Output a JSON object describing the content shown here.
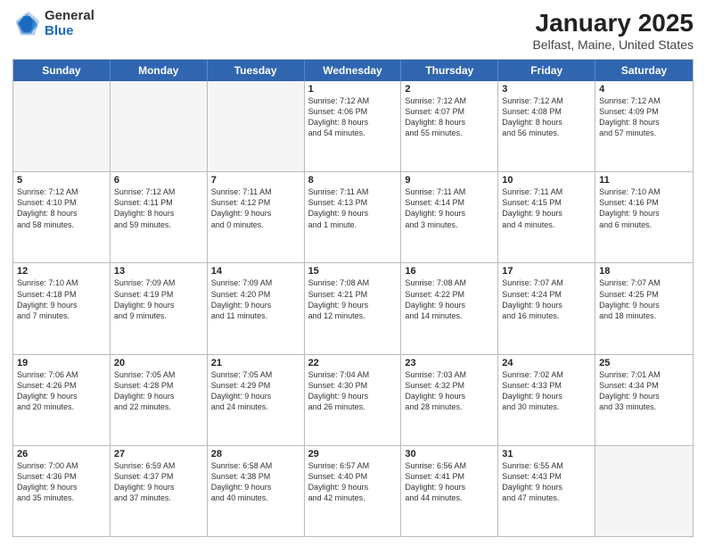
{
  "logo": {
    "general": "General",
    "blue": "Blue"
  },
  "title": {
    "month": "January 2025",
    "location": "Belfast, Maine, United States"
  },
  "header_days": [
    "Sunday",
    "Monday",
    "Tuesday",
    "Wednesday",
    "Thursday",
    "Friday",
    "Saturday"
  ],
  "rows": [
    [
      {
        "day": "",
        "info": "",
        "empty": true
      },
      {
        "day": "",
        "info": "",
        "empty": true
      },
      {
        "day": "",
        "info": "",
        "empty": true
      },
      {
        "day": "1",
        "info": "Sunrise: 7:12 AM\nSunset: 4:06 PM\nDaylight: 8 hours\nand 54 minutes.",
        "empty": false
      },
      {
        "day": "2",
        "info": "Sunrise: 7:12 AM\nSunset: 4:07 PM\nDaylight: 8 hours\nand 55 minutes.",
        "empty": false
      },
      {
        "day": "3",
        "info": "Sunrise: 7:12 AM\nSunset: 4:08 PM\nDaylight: 8 hours\nand 56 minutes.",
        "empty": false
      },
      {
        "day": "4",
        "info": "Sunrise: 7:12 AM\nSunset: 4:09 PM\nDaylight: 8 hours\nand 57 minutes.",
        "empty": false
      }
    ],
    [
      {
        "day": "5",
        "info": "Sunrise: 7:12 AM\nSunset: 4:10 PM\nDaylight: 8 hours\nand 58 minutes.",
        "empty": false
      },
      {
        "day": "6",
        "info": "Sunrise: 7:12 AM\nSunset: 4:11 PM\nDaylight: 8 hours\nand 59 minutes.",
        "empty": false
      },
      {
        "day": "7",
        "info": "Sunrise: 7:11 AM\nSunset: 4:12 PM\nDaylight: 9 hours\nand 0 minutes.",
        "empty": false
      },
      {
        "day": "8",
        "info": "Sunrise: 7:11 AM\nSunset: 4:13 PM\nDaylight: 9 hours\nand 1 minute.",
        "empty": false
      },
      {
        "day": "9",
        "info": "Sunrise: 7:11 AM\nSunset: 4:14 PM\nDaylight: 9 hours\nand 3 minutes.",
        "empty": false
      },
      {
        "day": "10",
        "info": "Sunrise: 7:11 AM\nSunset: 4:15 PM\nDaylight: 9 hours\nand 4 minutes.",
        "empty": false
      },
      {
        "day": "11",
        "info": "Sunrise: 7:10 AM\nSunset: 4:16 PM\nDaylight: 9 hours\nand 6 minutes.",
        "empty": false
      }
    ],
    [
      {
        "day": "12",
        "info": "Sunrise: 7:10 AM\nSunset: 4:18 PM\nDaylight: 9 hours\nand 7 minutes.",
        "empty": false
      },
      {
        "day": "13",
        "info": "Sunrise: 7:09 AM\nSunset: 4:19 PM\nDaylight: 9 hours\nand 9 minutes.",
        "empty": false
      },
      {
        "day": "14",
        "info": "Sunrise: 7:09 AM\nSunset: 4:20 PM\nDaylight: 9 hours\nand 11 minutes.",
        "empty": false
      },
      {
        "day": "15",
        "info": "Sunrise: 7:08 AM\nSunset: 4:21 PM\nDaylight: 9 hours\nand 12 minutes.",
        "empty": false
      },
      {
        "day": "16",
        "info": "Sunrise: 7:08 AM\nSunset: 4:22 PM\nDaylight: 9 hours\nand 14 minutes.",
        "empty": false
      },
      {
        "day": "17",
        "info": "Sunrise: 7:07 AM\nSunset: 4:24 PM\nDaylight: 9 hours\nand 16 minutes.",
        "empty": false
      },
      {
        "day": "18",
        "info": "Sunrise: 7:07 AM\nSunset: 4:25 PM\nDaylight: 9 hours\nand 18 minutes.",
        "empty": false
      }
    ],
    [
      {
        "day": "19",
        "info": "Sunrise: 7:06 AM\nSunset: 4:26 PM\nDaylight: 9 hours\nand 20 minutes.",
        "empty": false
      },
      {
        "day": "20",
        "info": "Sunrise: 7:05 AM\nSunset: 4:28 PM\nDaylight: 9 hours\nand 22 minutes.",
        "empty": false
      },
      {
        "day": "21",
        "info": "Sunrise: 7:05 AM\nSunset: 4:29 PM\nDaylight: 9 hours\nand 24 minutes.",
        "empty": false
      },
      {
        "day": "22",
        "info": "Sunrise: 7:04 AM\nSunset: 4:30 PM\nDaylight: 9 hours\nand 26 minutes.",
        "empty": false
      },
      {
        "day": "23",
        "info": "Sunrise: 7:03 AM\nSunset: 4:32 PM\nDaylight: 9 hours\nand 28 minutes.",
        "empty": false
      },
      {
        "day": "24",
        "info": "Sunrise: 7:02 AM\nSunset: 4:33 PM\nDaylight: 9 hours\nand 30 minutes.",
        "empty": false
      },
      {
        "day": "25",
        "info": "Sunrise: 7:01 AM\nSunset: 4:34 PM\nDaylight: 9 hours\nand 33 minutes.",
        "empty": false
      }
    ],
    [
      {
        "day": "26",
        "info": "Sunrise: 7:00 AM\nSunset: 4:36 PM\nDaylight: 9 hours\nand 35 minutes.",
        "empty": false
      },
      {
        "day": "27",
        "info": "Sunrise: 6:59 AM\nSunset: 4:37 PM\nDaylight: 9 hours\nand 37 minutes.",
        "empty": false
      },
      {
        "day": "28",
        "info": "Sunrise: 6:58 AM\nSunset: 4:38 PM\nDaylight: 9 hours\nand 40 minutes.",
        "empty": false
      },
      {
        "day": "29",
        "info": "Sunrise: 6:57 AM\nSunset: 4:40 PM\nDaylight: 9 hours\nand 42 minutes.",
        "empty": false
      },
      {
        "day": "30",
        "info": "Sunrise: 6:56 AM\nSunset: 4:41 PM\nDaylight: 9 hours\nand 44 minutes.",
        "empty": false
      },
      {
        "day": "31",
        "info": "Sunrise: 6:55 AM\nSunset: 4:43 PM\nDaylight: 9 hours\nand 47 minutes.",
        "empty": false
      },
      {
        "day": "",
        "info": "",
        "empty": true
      }
    ]
  ]
}
